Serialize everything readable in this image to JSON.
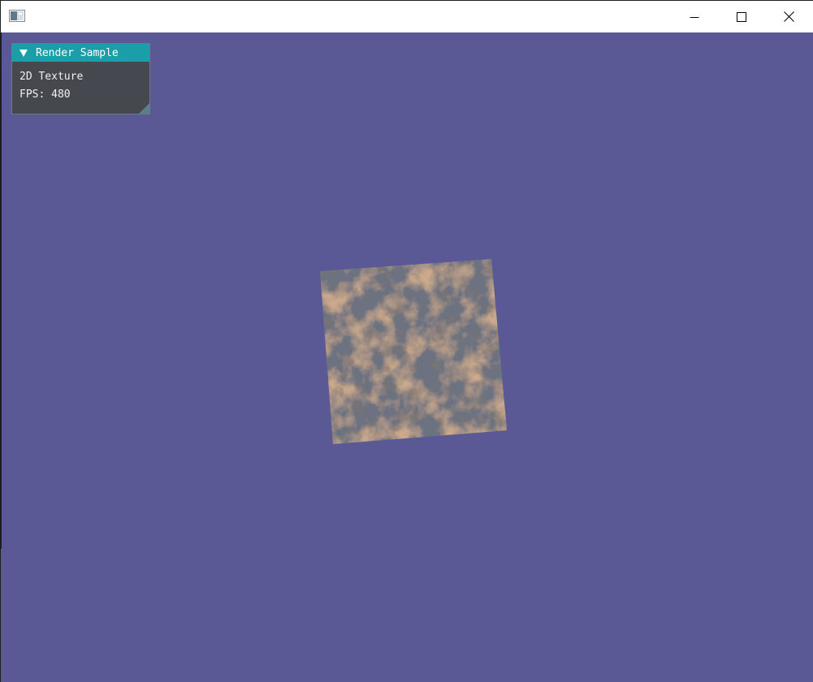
{
  "window": {
    "title": "",
    "icon": "app-window-icon",
    "buttons": {
      "minimize_icon": "minimize-icon",
      "maximize_icon": "maximize-icon",
      "close_icon": "close-icon"
    }
  },
  "viewport": {
    "background_color": "#5a5995"
  },
  "panel": {
    "title": "Render Sample",
    "collapse_icon": "triangle-down-icon",
    "header_color": "#1a9fa9",
    "line1": "2D Texture",
    "fps_label": "FPS:",
    "fps_value": "480"
  },
  "scene": {
    "object": "rotated-textured-quad",
    "texture": "rusty-metal",
    "texture_colors": {
      "base": "#6c7280",
      "rust": "#9a6a46",
      "dark": "#3d3430"
    }
  }
}
